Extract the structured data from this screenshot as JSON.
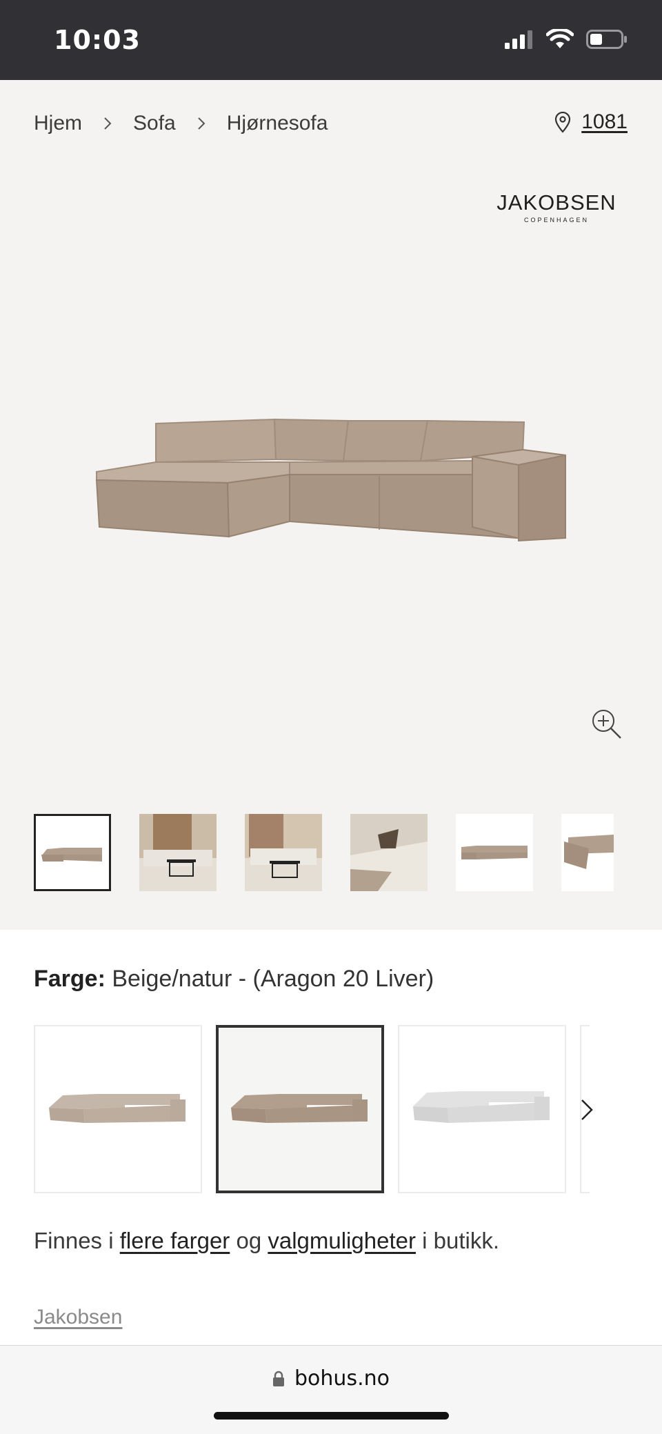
{
  "status_bar": {
    "time": "10:03"
  },
  "breadcrumb": {
    "items": [
      "Hjem",
      "Sofa",
      "Hjørnesofa"
    ]
  },
  "store": {
    "number": "1081"
  },
  "brand_logo": {
    "name": "JAKOBSEN",
    "tagline": "COPENHAGEN"
  },
  "product": {
    "color_label": "Farge:",
    "color_value": "Beige/natur - (Aragon 20 Liver)"
  },
  "availability": {
    "prefix": "Finnes i ",
    "link_colors": "flere farger",
    "middle": " og ",
    "link_options": "valgmuligheter",
    "suffix": " i butikk."
  },
  "brand_link": "Jakobsen",
  "browser": {
    "url": "bohus.no"
  },
  "colors": {
    "sofa": "#b19e8d",
    "sofa_light": "#c4b6a8",
    "sofa_grey": "#dcdcdc",
    "panel_bg": "#f4f3f1"
  }
}
